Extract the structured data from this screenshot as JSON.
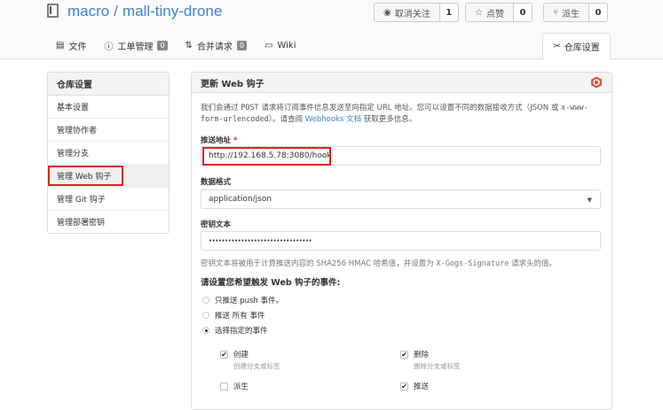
{
  "repo": {
    "owner": "macro",
    "name": "mall-tiny-drone"
  },
  "header_buttons": {
    "watch": {
      "label": "取消关注",
      "count": "1"
    },
    "star": {
      "label": "点赞",
      "count": "0"
    },
    "fork": {
      "label": "派生",
      "count": "0"
    }
  },
  "tabs": [
    {
      "label": "文件"
    },
    {
      "label": "工单管理",
      "badge": "0"
    },
    {
      "label": "合并请求",
      "badge": "0"
    },
    {
      "label": "Wiki"
    }
  ],
  "settings_tab": {
    "label": "仓库设置"
  },
  "sidebar": {
    "title": "仓库设置",
    "items": [
      {
        "label": "基本设置"
      },
      {
        "label": "管理协作者"
      },
      {
        "label": "管理分支"
      },
      {
        "label": "管理 Web 钩子"
      },
      {
        "label": "管理 Git 钩子"
      },
      {
        "label": "管理部署密钥"
      }
    ]
  },
  "main": {
    "title": "更新 Web 钩子",
    "desc_part1": "我们会通过 ",
    "desc_post": "POST",
    "desc_part2": " 请求将订阅事件信息发送至向指定 URL 地址。您可以设置不同的数据接收方式（JSON 或 ",
    "desc_mime": "x-www-form-urlencoded",
    "desc_part3": "）。请查阅 ",
    "desc_link": "Webhooks 文档",
    "desc_part4": " 获取更多信息。",
    "url_label": "推送地址",
    "url_required": "*",
    "url_value": "http://192.168.5.78:3080/hook",
    "format_label": "数据格式",
    "format_value": "application/json",
    "secret_label": "密钥文本",
    "secret_value": "••••••••••••••••••••••••••••••••",
    "hint_part1": "密钥文本将被用于计算推送内容的 SHA256 HMAC 哈希值，并设置为 ",
    "hint_mono": "X-Gogs-Signature",
    "hint_part2": " 请求头的值。",
    "events_title": "请设置您希望触发 Web 钩子的事件:",
    "radios": [
      {
        "prefix": "只推送 ",
        "keyword": "push",
        "suffix": " 事件。",
        "checked": false
      },
      {
        "prefix": "推送 ",
        "keyword": "所有",
        "suffix": " 事件",
        "checked": false
      },
      {
        "prefix": "选择指定的事件",
        "keyword": "",
        "suffix": "",
        "checked": true
      }
    ],
    "events": [
      {
        "title": "创建",
        "sub": "创建分支或标签",
        "checked": true
      },
      {
        "title": "删除",
        "sub": "删除分支或标签",
        "checked": true
      },
      {
        "title": "派生",
        "sub": "",
        "checked": false
      },
      {
        "title": "推送",
        "sub": "",
        "checked": true
      }
    ]
  },
  "colors": {
    "link": "#4183c4",
    "highlight": "#dd2222",
    "gogs": "#e0543a"
  }
}
